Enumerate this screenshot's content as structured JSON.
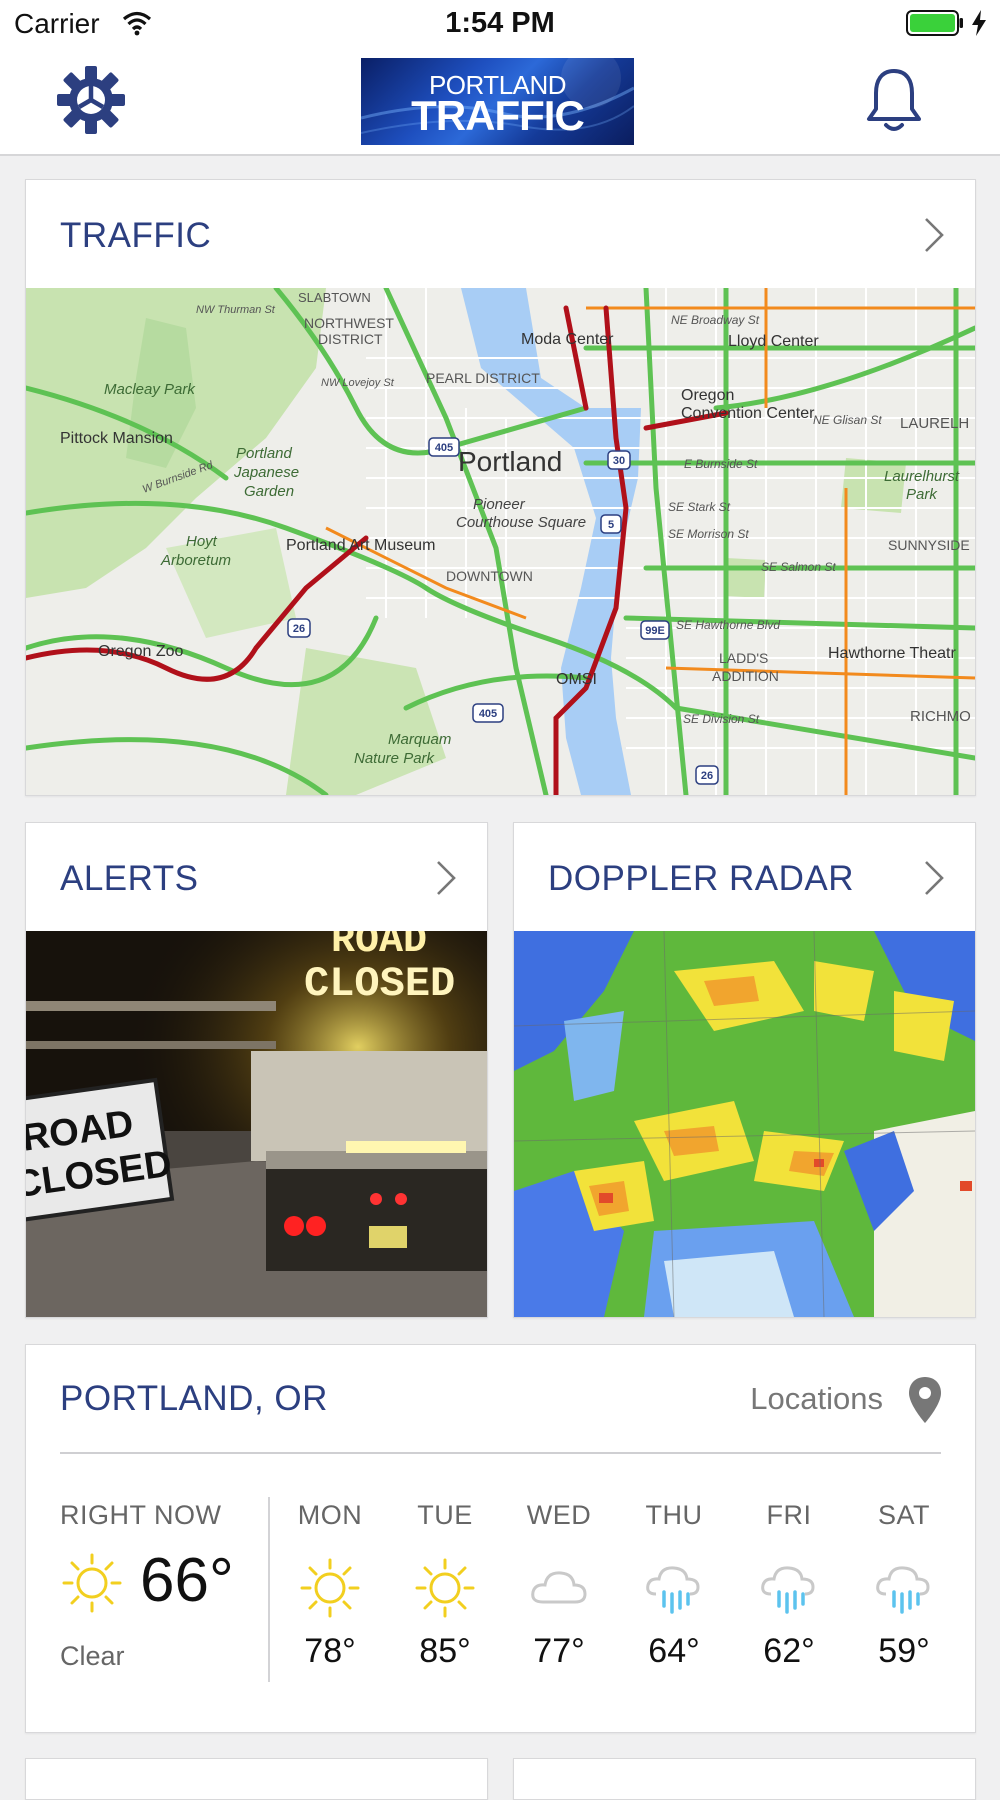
{
  "status_bar": {
    "carrier": "Carrier",
    "time": "1:54 PM",
    "battery_color": "#3ad13a"
  },
  "header": {
    "logo_line1": "PORTLAND",
    "logo_line2": "TRAFFIC",
    "settings_icon": "gear-icon",
    "notifications_icon": "bell-icon"
  },
  "traffic_card": {
    "title": "TRAFFIC",
    "map_labels": {
      "slabtown": "SLABTOWN",
      "nw_thurman": "NW Thurman St",
      "northwest": "NORTHWEST",
      "district": "DISTRICT",
      "macleay": "Macleay Park",
      "nw_lovejoy": "NW Lovejoy St",
      "pearl": "PEARL DISTRICT",
      "moda": "Moda Center",
      "ne_broadway": "NE Broadway St",
      "lloyd": "Lloyd Center",
      "oregon": "Oregon",
      "convention": "Convention Center",
      "ne_glisan": "NE Glisan St",
      "laurelh": "LAURELH",
      "pittock": "Pittock Mansion",
      "burnside_rd": "W Burnside Rd",
      "japanese_1": "Portland",
      "japanese_2": "Japanese",
      "japanese_3": "Garden",
      "portland": "Portland",
      "e_burnside": "E Burnside St",
      "laurelhurst_1": "Laurelhurst",
      "laurelhurst_2": "Park",
      "pioneer_1": "Pioneer",
      "pioneer_2": "Courthouse Square",
      "se_stark": "SE Stark St",
      "se_morrison": "SE Morrison St",
      "sunnyside": "SUNNYSIDE",
      "hoyt_1": "Hoyt",
      "hoyt_2": "Arboretum",
      "art_museum": "Portland Art Museum",
      "se_salmon": "SE Salmon St",
      "downtown": "DOWNTOWN",
      "se_hawthorne": "SE Hawthorne Blvd",
      "oregon_zoo": "Oregon Zoo",
      "ladds_1": "LADD'S",
      "ladds_2": "ADDITION",
      "hawthorne_theatre": "Hawthorne Theatr",
      "omsi": "OMSI",
      "se_division": "SE Division St",
      "richmo": "RICHMO",
      "marquam_1": "Marquam",
      "marquam_2": "Nature Park",
      "shield_405a": "405",
      "shield_405b": "405",
      "shield_30": "30",
      "shield_5": "5",
      "shield_26a": "26",
      "shield_26b": "26",
      "shield_99e": "99E"
    }
  },
  "alerts_card": {
    "title": "ALERTS",
    "sign_line1": "ROAD",
    "sign_line2": "CLOSED",
    "board_line1": "ROAD",
    "board_line2": "CLOSED"
  },
  "radar_card": {
    "title": "DOPPLER RADAR"
  },
  "weather": {
    "location": "PORTLAND, OR",
    "locations_link": "Locations",
    "right_now_label": "RIGHT NOW",
    "right_now_temp": "66°",
    "right_now_condition": "Clear",
    "forecast": [
      {
        "day": "MON",
        "temp": "78°",
        "icon": "sun-icon"
      },
      {
        "day": "TUE",
        "temp": "85°",
        "icon": "sun-icon"
      },
      {
        "day": "WED",
        "temp": "77°",
        "icon": "cloud-icon"
      },
      {
        "day": "THU",
        "temp": "64°",
        "icon": "rain-icon"
      },
      {
        "day": "FRI",
        "temp": "62°",
        "icon": "rain-icon"
      },
      {
        "day": "SAT",
        "temp": "59°",
        "icon": "rain-icon"
      }
    ]
  },
  "colors": {
    "title_blue": "#2c3f80",
    "sun_yellow": "#f2cf1f",
    "rain_blue": "#5cc3ee",
    "cloud_grey": "#c9c9c9"
  }
}
